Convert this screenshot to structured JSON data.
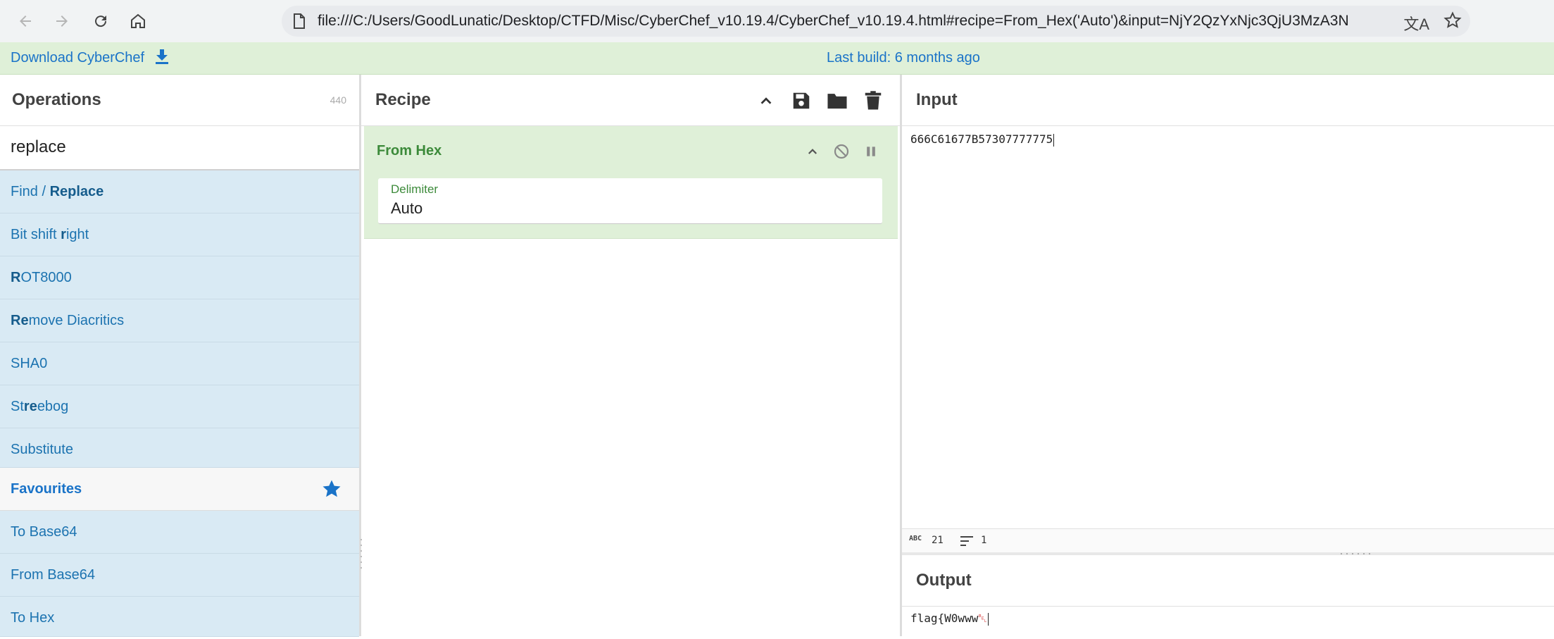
{
  "browser": {
    "url": "file:///C:/Users/GoodLunatic/Desktop/CTFD/Misc/CyberChef_v10.19.4/CyberChef_v10.19.4.html#recipe=From_Hex('Auto')&input=NjY2QzYxNjc3QjU3MzA3N",
    "icons": [
      "back-icon",
      "forward-icon",
      "reload-icon",
      "home-icon",
      "page-info-icon",
      "translate-icon",
      "bookmark-star-icon"
    ]
  },
  "banner": {
    "download_label": "Download CyberChef",
    "build_label": "Last build: 6 months ago"
  },
  "operations": {
    "title": "Operations",
    "count": "440",
    "search_value": "replace",
    "items": [
      {
        "pre": "Find / ",
        "bold": "Replace",
        "post": ""
      },
      {
        "pre": "Bit shift ",
        "bold": "r",
        "post": "ight"
      },
      {
        "pre": "",
        "bold": "R",
        "post": "OT8000"
      },
      {
        "pre": "",
        "bold": "Re",
        "post": "move Diacritics"
      },
      {
        "pre": "SHA0",
        "bold": "",
        "post": ""
      },
      {
        "pre": "St",
        "bold": "re",
        "post": "ebog"
      },
      {
        "pre": "Substitute",
        "bold": "",
        "post": ""
      }
    ],
    "favourites_label": "Favourites",
    "favourite_items": [
      "To Base64",
      "From Base64",
      "To Hex"
    ]
  },
  "recipe": {
    "title": "Recipe",
    "operation": {
      "name": "From Hex",
      "arg_label": "Delimiter",
      "arg_value": "Auto"
    }
  },
  "input": {
    "title": "Input",
    "text": "666C61677B57307777775",
    "length": "21",
    "lines": "1"
  },
  "output": {
    "title": "Output",
    "text": "flag{W0www",
    "trailing_char": "␇"
  },
  "colors": {
    "banner_bg": "#dff0d8",
    "op_item_bg": "#d9eaf4",
    "accent_blue": "#1a73c8",
    "recipe_green": "#3c8a3a"
  }
}
